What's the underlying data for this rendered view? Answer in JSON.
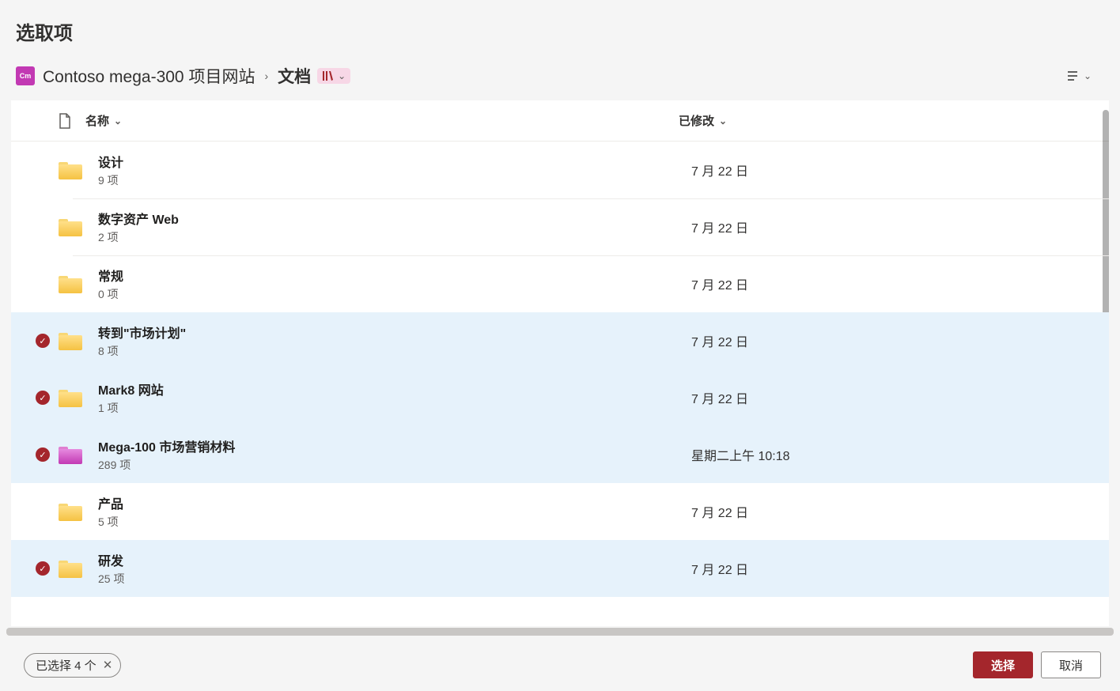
{
  "dialog_title": "选取项",
  "breadcrumb": {
    "site_name": "Contoso mega-300 项目网站",
    "current": "文档"
  },
  "columns": {
    "name": "名称",
    "modified": "已修改"
  },
  "items": [
    {
      "name": "设计",
      "sub": "9 项",
      "modified": "7 月 22 日",
      "selected": false,
      "color": "yellow"
    },
    {
      "name": "数字资产 Web",
      "sub": "2 项",
      "modified": "7 月 22 日",
      "selected": false,
      "color": "yellow"
    },
    {
      "name": "常规",
      "sub": "0 项",
      "modified": "7 月 22 日",
      "selected": false,
      "color": "yellow"
    },
    {
      "name": "转到\"市场计划\"",
      "sub": "8 项",
      "modified": "7 月 22 日",
      "selected": true,
      "color": "yellow"
    },
    {
      "name": "Mark8 网站",
      "sub": "1 项",
      "modified": "7 月 22 日",
      "selected": true,
      "color": "yellow"
    },
    {
      "name": "Mega-100 市场营销材料",
      "sub": "289 项",
      "modified": "星期二上午 10:18",
      "selected": true,
      "color": "pink"
    },
    {
      "name": "产品",
      "sub": "5 项",
      "modified": "7 月 22 日",
      "selected": false,
      "color": "yellow"
    },
    {
      "name": "研发",
      "sub": "25 项",
      "modified": "7 月 22 日",
      "selected": true,
      "color": "yellow"
    }
  ],
  "footer": {
    "selection_text": "已选择 4 个",
    "primary": "选择",
    "secondary": "取消"
  }
}
